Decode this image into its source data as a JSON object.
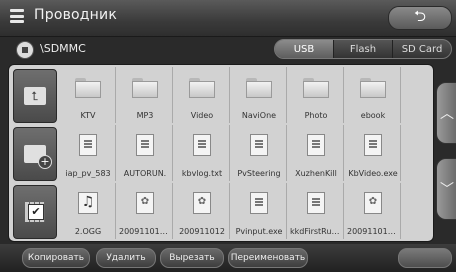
{
  "title": "Проводник",
  "path": "\\SDMMC",
  "tabs": [
    "USB",
    "Flash",
    "SD Card"
  ],
  "active_tab": "USB",
  "side_buttons": [
    "up-folder",
    "new-folder",
    "select-all"
  ],
  "files": [
    {
      "name": "KTV",
      "icon": "folder"
    },
    {
      "name": "MP3",
      "icon": "folder"
    },
    {
      "name": "Video",
      "icon": "folder"
    },
    {
      "name": "NaviOne",
      "icon": "folder"
    },
    {
      "name": "Photo",
      "icon": "folder"
    },
    {
      "name": "ebook",
      "icon": "folder"
    },
    {
      "name": "iap_pv_583",
      "icon": "doc"
    },
    {
      "name": "AUTORUN.",
      "icon": "doc"
    },
    {
      "name": "kbvlog.txt",
      "icon": "doc"
    },
    {
      "name": "PvSteering",
      "icon": "doc"
    },
    {
      "name": "XuzhenKill",
      "icon": "doc"
    },
    {
      "name": "KbVideo.exe",
      "icon": "doc"
    },
    {
      "name": "2.OGG",
      "icon": "music"
    },
    {
      "name": "200911011...",
      "icon": "image"
    },
    {
      "name": "200911012",
      "icon": "image"
    },
    {
      "name": "Pvinput.exe",
      "icon": "doc"
    },
    {
      "name": "kkdFirstRun...",
      "icon": "doc"
    },
    {
      "name": "200911013...",
      "icon": "image"
    }
  ],
  "actions": {
    "copy": "Копировать",
    "delete": "Удалить",
    "cut": "Вырезать",
    "rename": "Переименовать"
  }
}
